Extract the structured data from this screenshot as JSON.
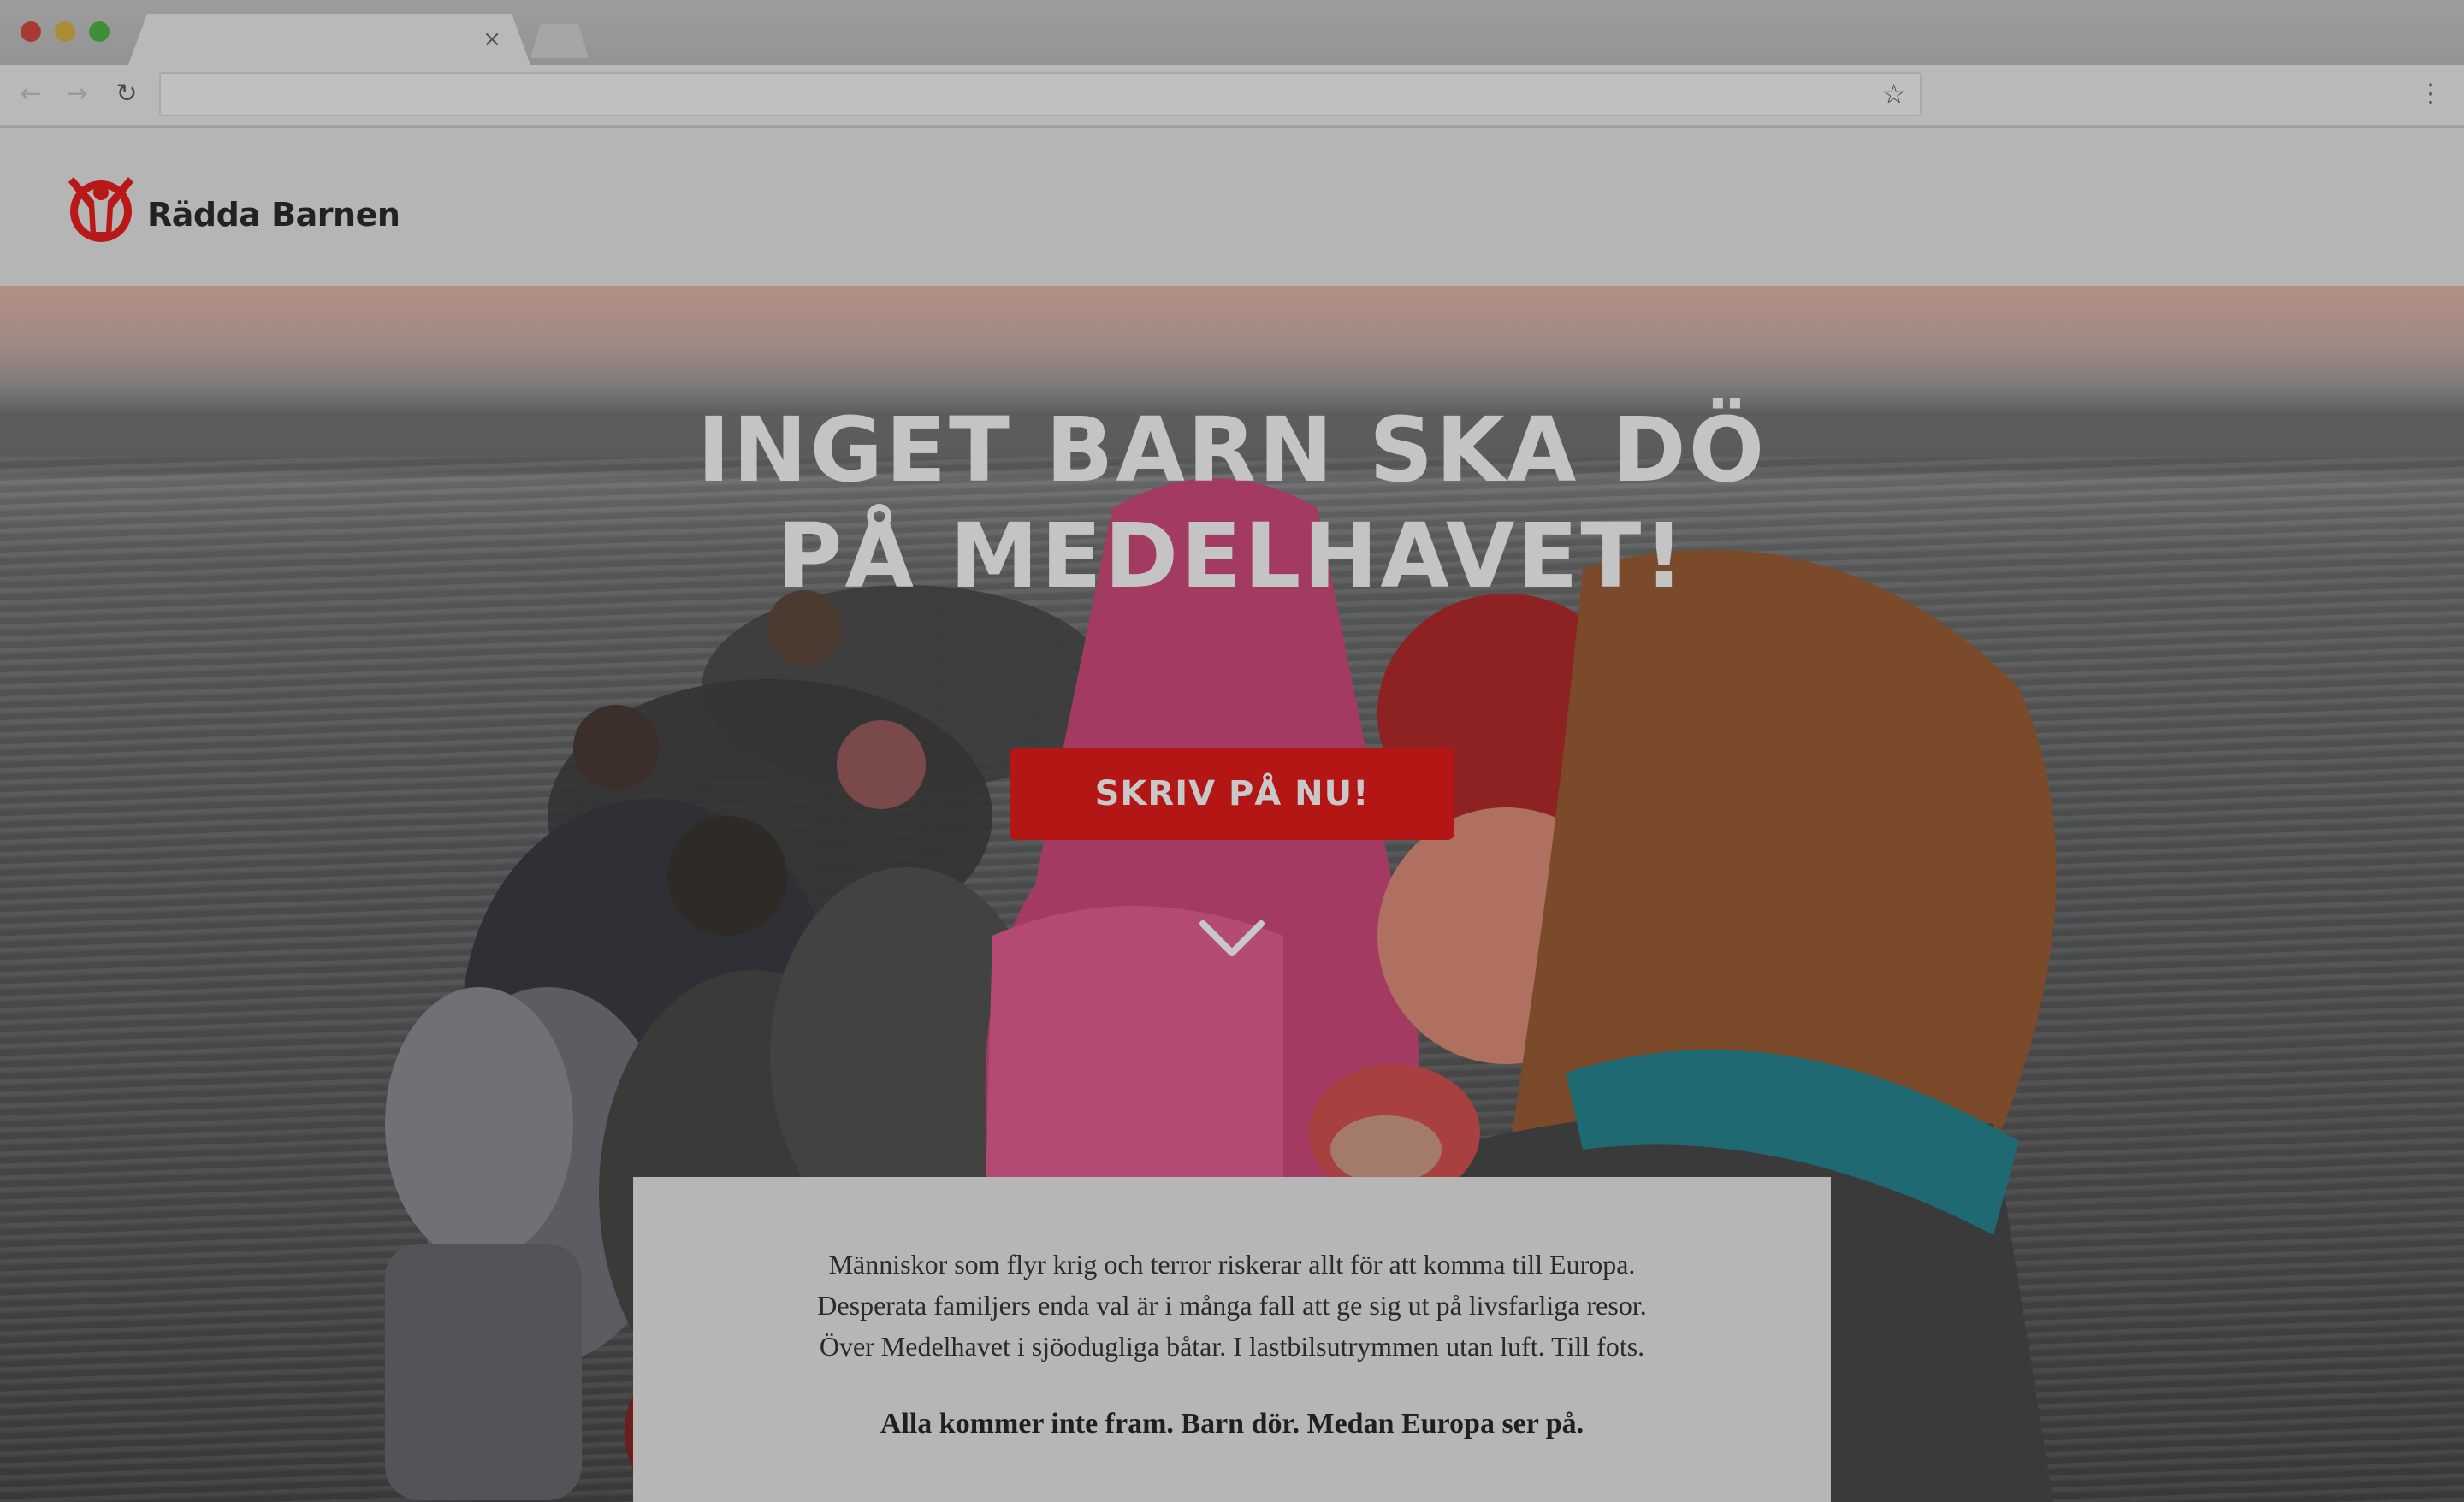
{
  "browser": {
    "tab_close_glyph": "×",
    "back_glyph": "←",
    "forward_glyph": "→",
    "reload_glyph": "↻",
    "bookmark_glyph": "☆",
    "menu_glyph": "⋮",
    "address": ""
  },
  "header": {
    "logo_text": "Rädda Barnen",
    "logo_icon": "child-arms-raised-icon",
    "brand_color": "#c41e1e"
  },
  "hero": {
    "title_line1": "INGET BARN SKA DÖ",
    "title_line2": "PÅ MEDELHAVET!",
    "cta_label": "SKRIV PÅ NU!",
    "scroll_icon": "chevron-down-icon"
  },
  "intro": {
    "lines": [
      "Människor som flyr krig och terror riskerar allt för att komma till Europa.",
      "Desperata familjers enda val är i många fall att ge sig ut på livsfarliga resor.",
      "Över Medelhavet i sjöodugliga båtar. I lastbilsutrymmen utan luft. Till fots."
    ],
    "tagline": "Alla kommer inte fram. Barn dör. Medan Europa ser på."
  }
}
